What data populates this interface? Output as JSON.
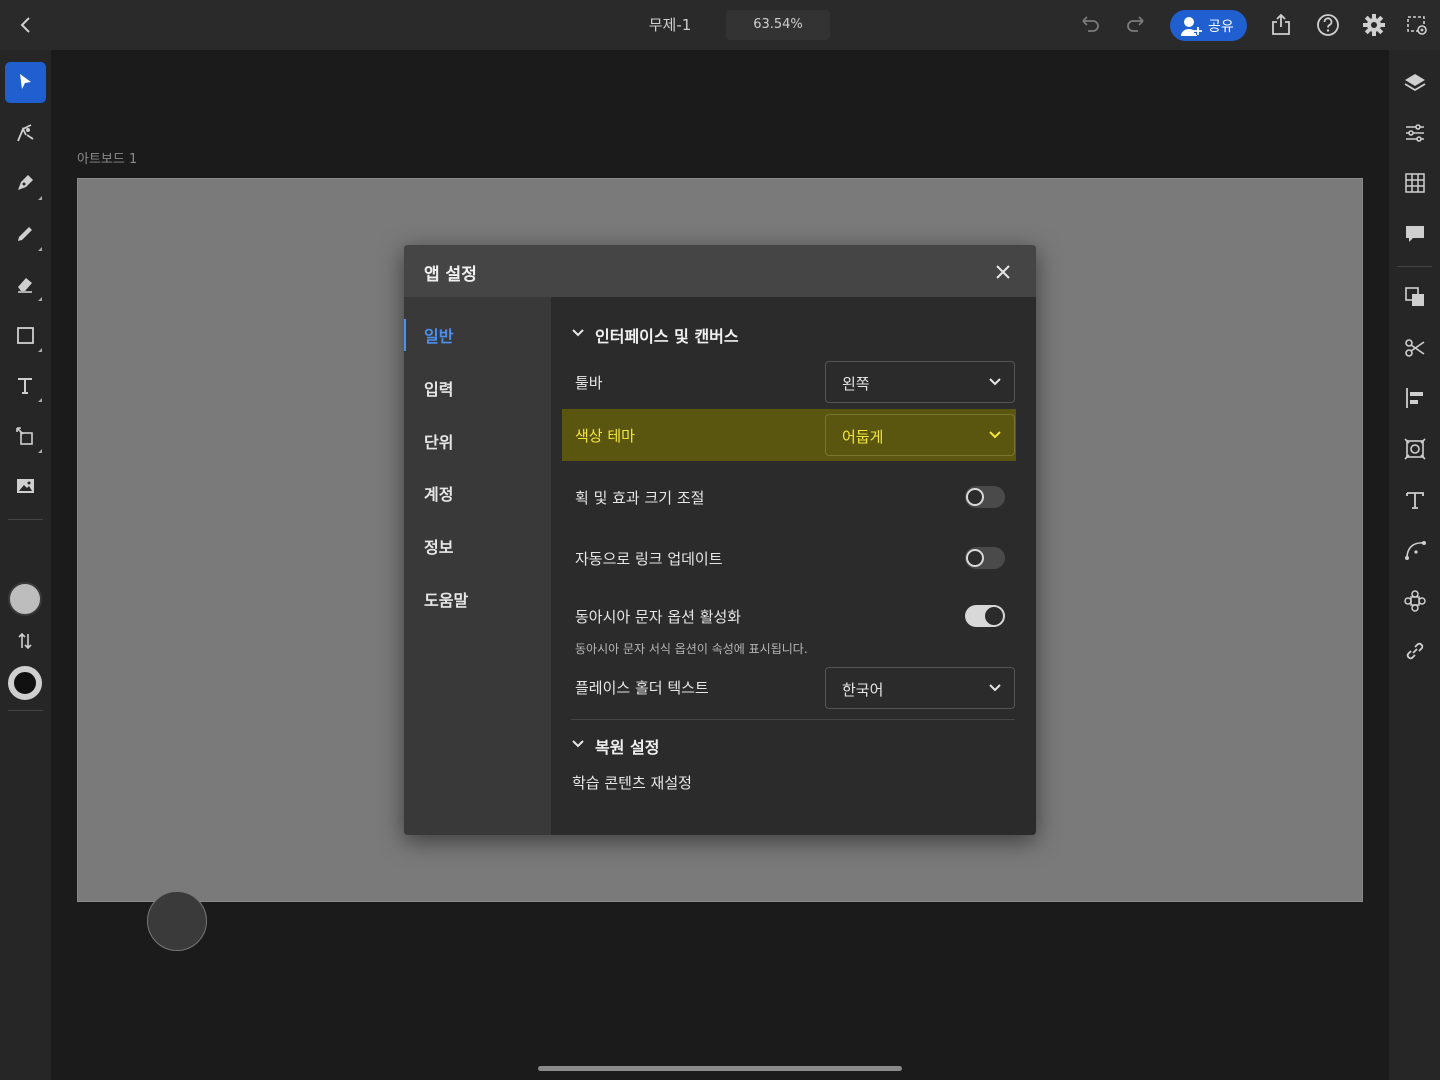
{
  "topbar": {
    "title": "무제-1",
    "zoom": "63.54%",
    "share_label": "공유"
  },
  "canvas": {
    "artboard_label": "아트보드 1"
  },
  "dialog": {
    "title": "앱 설정",
    "nav": [
      "일반",
      "입력",
      "단위",
      "계정",
      "정보",
      "도움말"
    ],
    "active_nav": "일반",
    "section_interface": {
      "title": "인터페이스 및 캔버스",
      "toolbar_label": "툴바",
      "toolbar_value": "왼쪽",
      "theme_label": "색상 테마",
      "theme_value": "어둡게",
      "scale_label": "획 및 효과 크기 조절",
      "scale_on": false,
      "auto_link_label": "자동으로 링크 업데이트",
      "auto_link_on": false,
      "east_asian_label": "동아시아 문자 옵션 활성화",
      "east_asian_on": true,
      "east_asian_desc": "동아시아 문자 서식 옵션이 속성에 표시됩니다.",
      "placeholder_label": "플레이스 홀더 텍스트",
      "placeholder_value": "한국어"
    },
    "section_restore": {
      "title": "복원 설정",
      "reset_label": "학습 콘텐츠 재설정"
    }
  },
  "colors": {
    "accent": "#1f5fd0",
    "highlight_bg": "#5a560f",
    "highlight_text": "#f3e63a"
  },
  "icons": {
    "topbar": [
      "back-icon",
      "undo-icon",
      "redo-icon",
      "share-person-icon",
      "export-icon",
      "help-icon",
      "gear-icon",
      "preview-icon"
    ],
    "left_toolbar": [
      "select-icon",
      "direct-select-icon",
      "pen-icon",
      "pencil-icon",
      "eraser-icon",
      "rectangle-icon",
      "type-icon",
      "transform-icon",
      "image-icon",
      "swap-icon"
    ],
    "right_toolbar": [
      "layers-icon",
      "properties-icon",
      "libraries-icon",
      "comments-icon",
      "arrange-icon",
      "cut-icon",
      "align-icon",
      "repeat-icon",
      "type-properties-icon",
      "path-icon",
      "pattern-icon",
      "link-icon"
    ]
  }
}
